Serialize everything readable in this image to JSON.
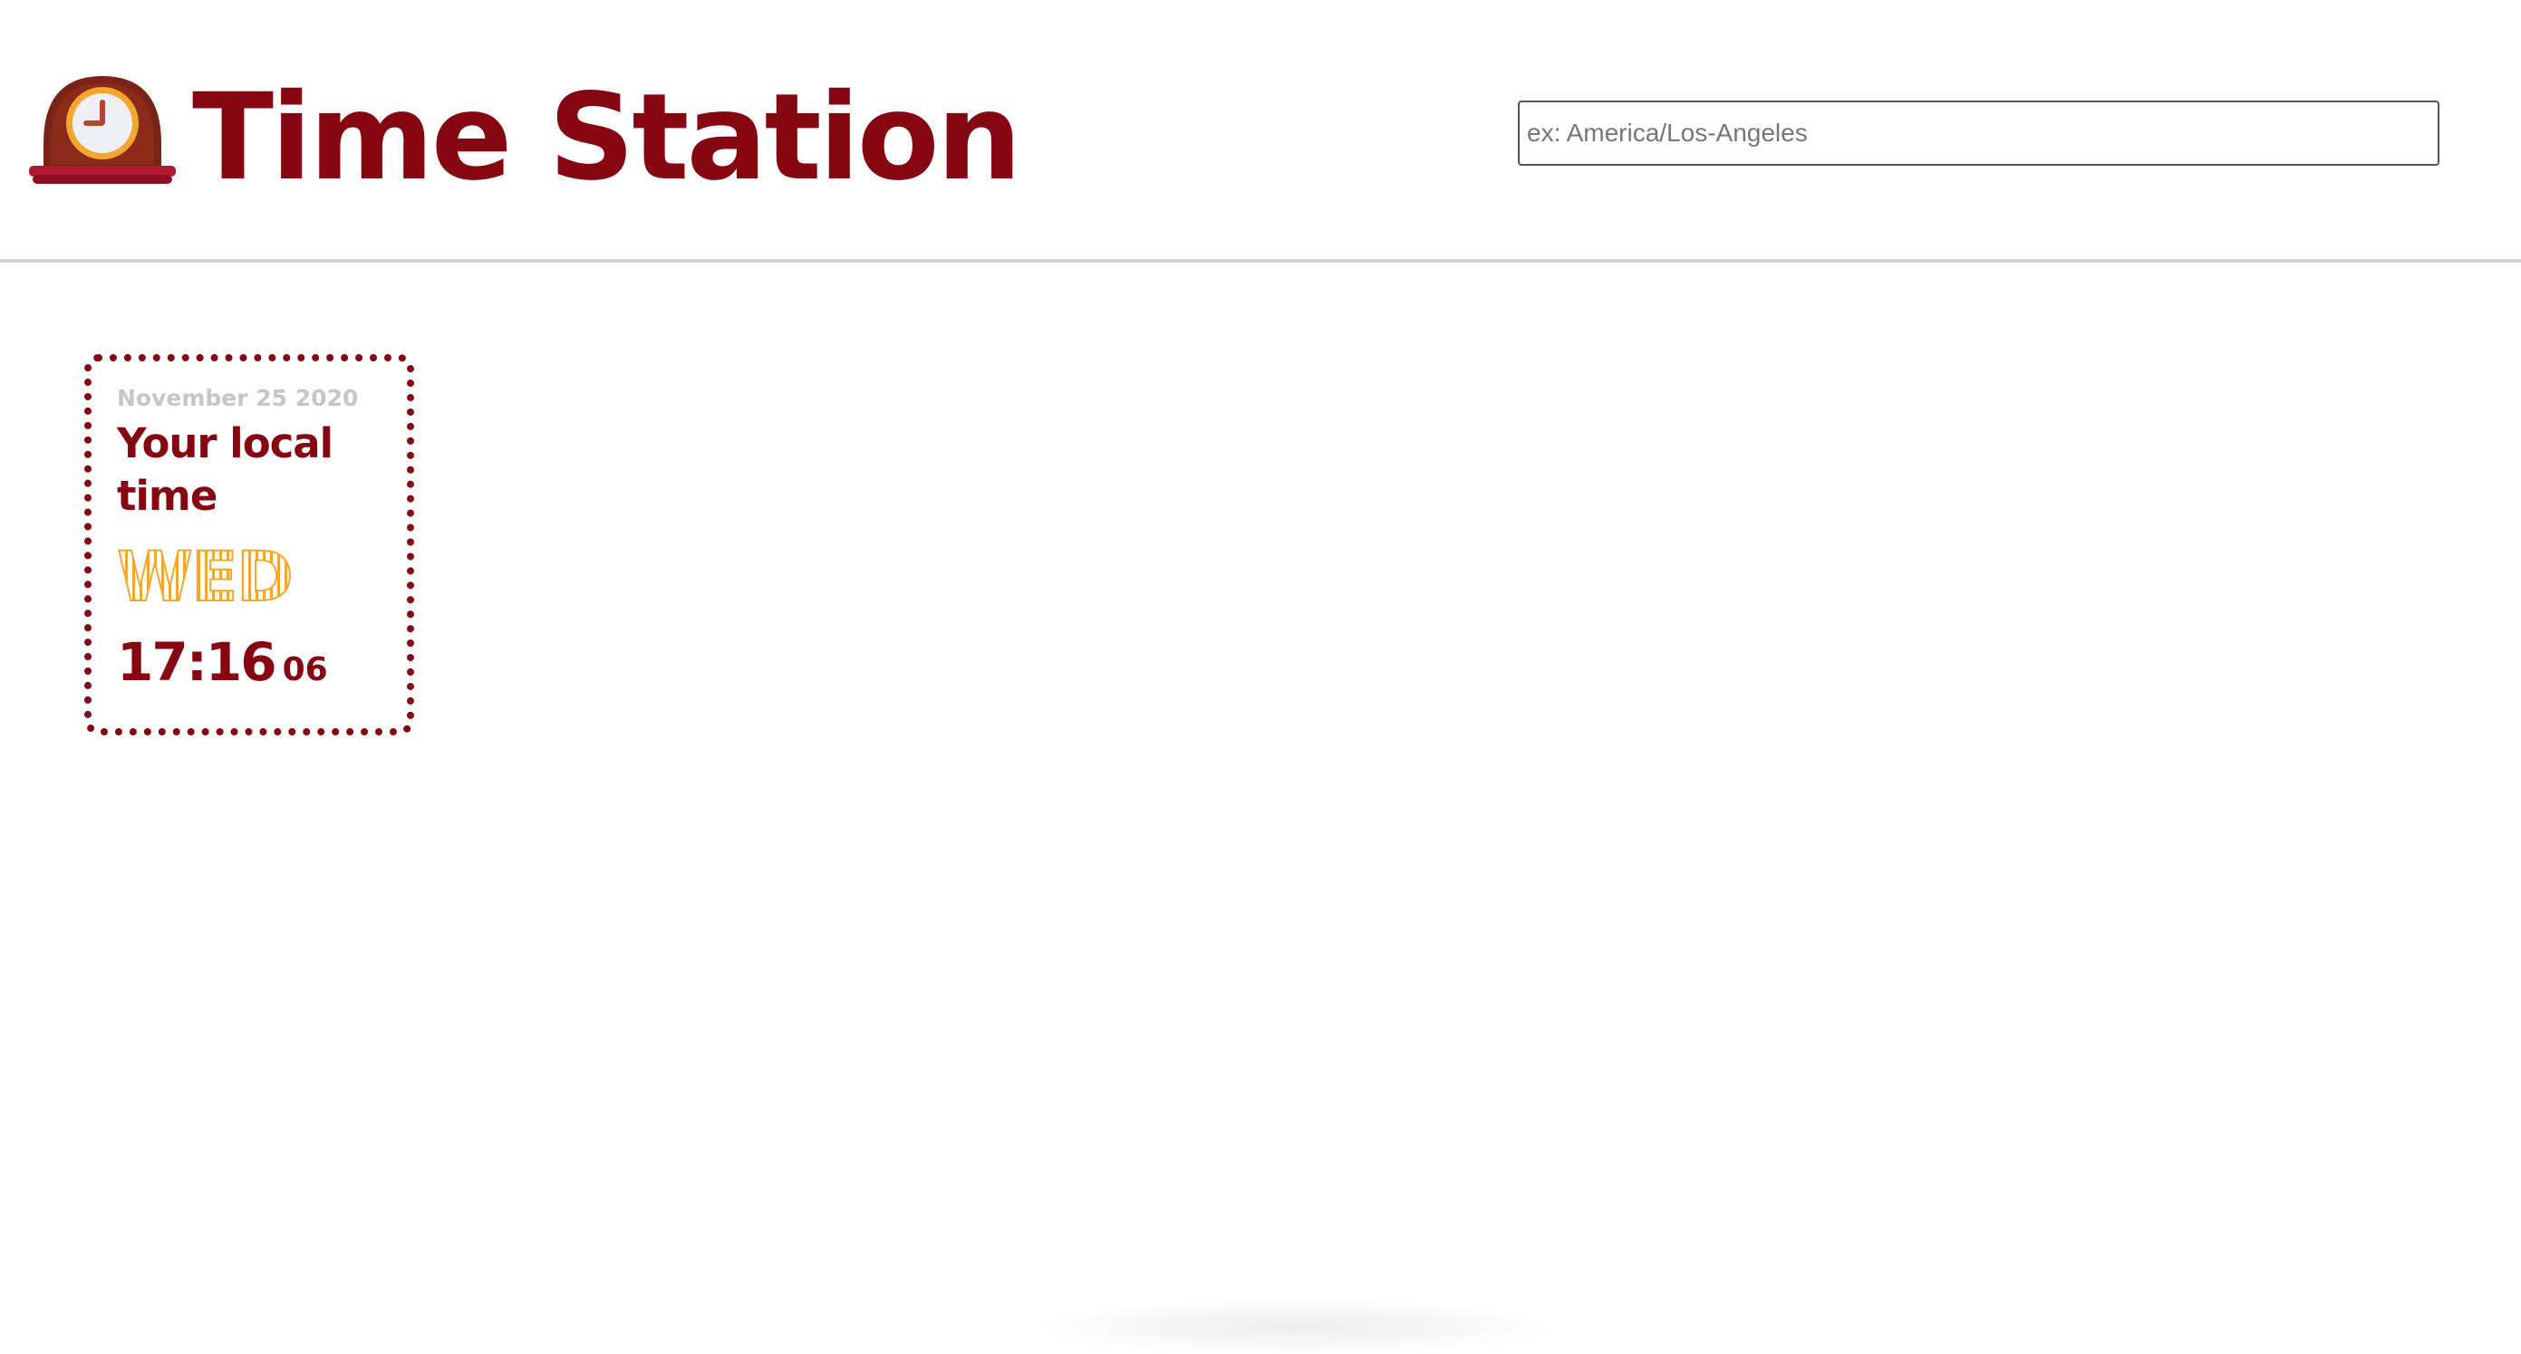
{
  "header": {
    "title": "Time Station",
    "logo_icon": "mantelpiece-clock-icon",
    "brand_color": "#860711"
  },
  "search": {
    "placeholder": "ex: America/Los-Angeles",
    "value": ""
  },
  "clocks": [
    {
      "date": "November 25 2020",
      "label": "Your local time",
      "day": "WED",
      "time_hm": "17:16",
      "time_sec": "06",
      "day_color": "#f0a830"
    }
  ]
}
